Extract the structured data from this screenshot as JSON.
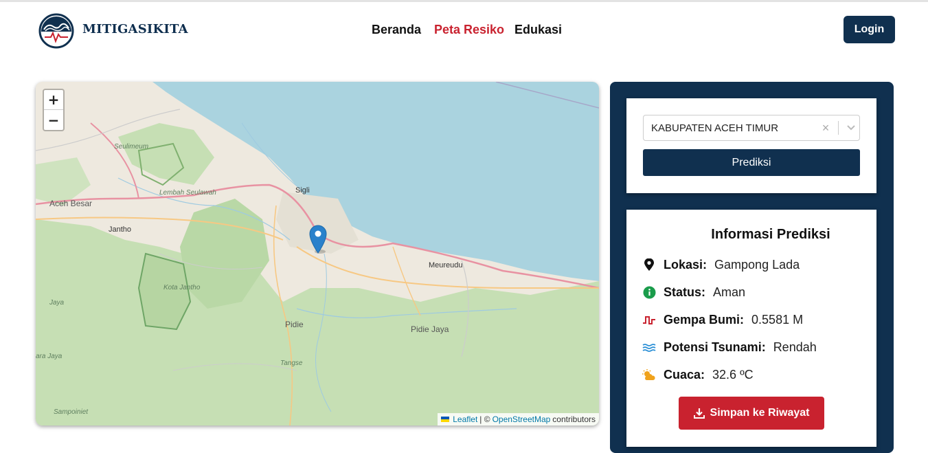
{
  "brand": {
    "name": "MITIGASIKITA",
    "logo_icon": "tsunami-wave-logo"
  },
  "nav": {
    "items": [
      {
        "label": "Beranda",
        "active": false
      },
      {
        "label": "Peta Resiko",
        "active": true
      },
      {
        "label": "Edukasi",
        "active": false
      }
    ],
    "login_label": "Login",
    "active_color": "#c9222f"
  },
  "map": {
    "zoom_in": "+",
    "zoom_out": "−",
    "places": [
      "Sigli",
      "Aceh Besar",
      "Jantho",
      "Seulimeum",
      "Lembah Seulawah",
      "Kota Jantho",
      "Meureudu",
      "Pidie",
      "Pidie Jaya",
      "Tangse",
      "Jaya",
      "Sampoiniet",
      "ara Jaya"
    ],
    "attribution": {
      "leaflet": "Leaflet",
      "separator": "| ©",
      "osm": "OpenStreetMap",
      "suffix": "contributors"
    },
    "marker_icon": "map-pin-icon"
  },
  "panel": {
    "select_value": "KABUPATEN ACEH TIMUR",
    "clear_icon": "×",
    "predict_label": "Prediksi",
    "info_title": "Informasi Prediksi",
    "rows": [
      {
        "icon": "location-pin-icon",
        "label": "Lokasi:",
        "value": "Gampong Lada"
      },
      {
        "icon": "info-circle-icon",
        "label": "Status:",
        "value": "Aman"
      },
      {
        "icon": "seismic-wave-icon",
        "label": "Gempa Bumi:",
        "value": "0.5581 M"
      },
      {
        "icon": "water-waves-icon",
        "label": "Potensi Tsunami:",
        "value": "Rendah"
      },
      {
        "icon": "cloud-sun-icon",
        "label": "Cuaca:",
        "value": "32.6 ºC"
      }
    ],
    "save_label": "Simpan ke Riwayat",
    "save_icon": "download-icon"
  },
  "colors": {
    "navy": "#10304f",
    "red": "#c9222f",
    "sea": "#aad3df",
    "forest": "#add19e"
  }
}
